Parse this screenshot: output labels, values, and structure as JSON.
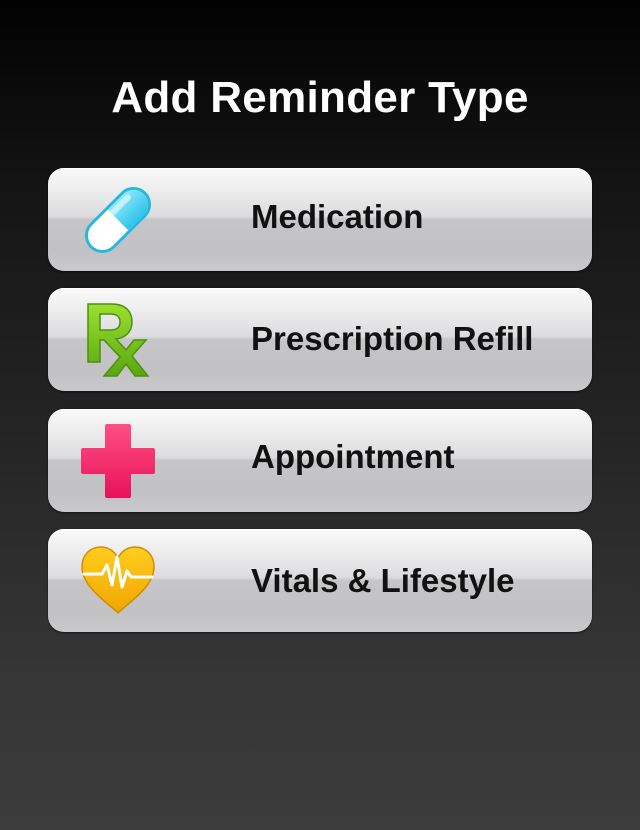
{
  "page": {
    "title": "Add Reminder Type"
  },
  "reminder_types": [
    {
      "label": "Medication",
      "icon": "pill-icon",
      "icon_color": "#3ec6e6"
    },
    {
      "label": "Prescription Refill",
      "icon": "rx-icon",
      "icon_color": "#7cc623"
    },
    {
      "label": "Appointment",
      "icon": "medical-cross-icon",
      "icon_color": "#f0195e"
    },
    {
      "label": "Vitals & Lifestyle",
      "icon": "heart-pulse-icon",
      "icon_color": "#f5b800"
    }
  ]
}
